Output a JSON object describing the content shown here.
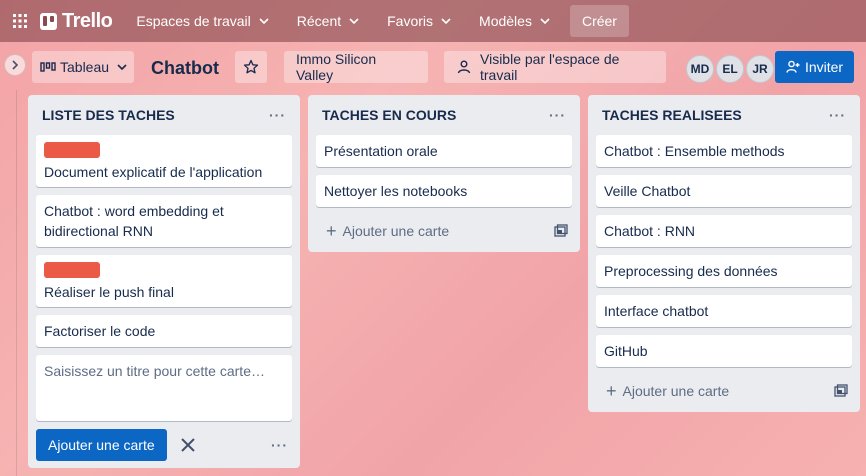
{
  "topbar": {
    "logo": "Trello",
    "nav": [
      {
        "label": "Espaces de travail"
      },
      {
        "label": "Récent"
      },
      {
        "label": "Favoris"
      },
      {
        "label": "Modèles"
      }
    ],
    "create_label": "Créer"
  },
  "board": {
    "view_label": "Tableau",
    "title": "Chatbot",
    "workspace": "Immo Silicon Valley",
    "visibility": "Visible par l'espace de travail",
    "members": [
      "MD",
      "EL",
      "JR"
    ],
    "invite_label": "Inviter"
  },
  "lists": [
    {
      "title": "LISTE DES TACHES",
      "menu": "···",
      "cards": [
        {
          "text": "Document explicatif de l'application",
          "label_color": "#eb5a46"
        },
        {
          "text": "Chatbot : word embedding et bidirectional RNN"
        },
        {
          "text": "Réaliser le push final",
          "label_color": "#eb5a46"
        },
        {
          "text": "Factoriser le code"
        }
      ],
      "composer": {
        "placeholder": "Saisissez un titre pour cette carte…",
        "add_label": "Ajouter une carte",
        "menu": "···"
      }
    },
    {
      "title": "TACHES EN COURS",
      "menu": "···",
      "cards": [
        {
          "text": "Présentation orale"
        },
        {
          "text": "Nettoyer les notebooks"
        }
      ],
      "add_card_label": "Ajouter une carte"
    },
    {
      "title": "TACHES REALISEES",
      "menu": "···",
      "cards": [
        {
          "text": "Chatbot : Ensemble methods"
        },
        {
          "text": "Veille Chatbot"
        },
        {
          "text": "Chatbot : RNN"
        },
        {
          "text": "Preprocessing des données"
        },
        {
          "text": "Interface chatbot"
        },
        {
          "text": "GitHub"
        }
      ],
      "add_card_label": "Ajouter une carte"
    }
  ],
  "colors": {
    "accent": "#0c66c4",
    "label_red": "#eb5a46",
    "list_bg": "#ebecf0"
  }
}
